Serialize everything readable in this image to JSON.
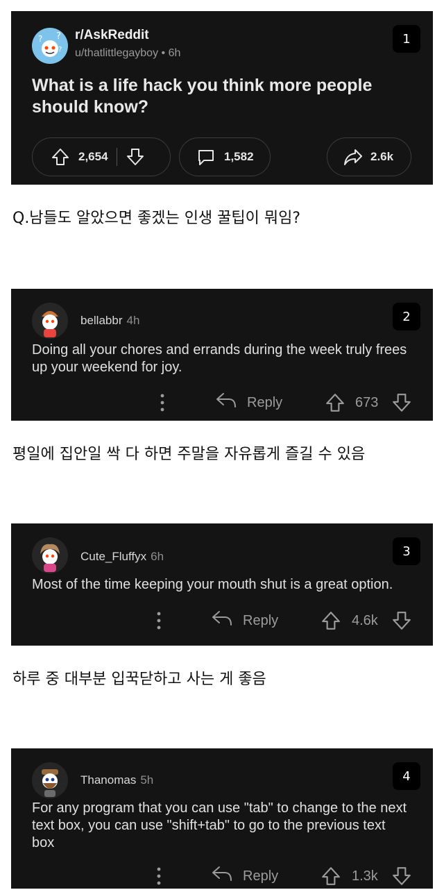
{
  "post": {
    "subreddit": "r/AskReddit",
    "author": "u/thatlittlegayboy",
    "age": "6h",
    "title": "What is a life hack you think more people should know?",
    "upvotes": "2,654",
    "comments": "1,582",
    "shares": "2.6k",
    "number": "1"
  },
  "captions": [
    "Q.남들도 알았으면 좋겠는 인생 꿀팁이 뭐임?",
    "평일에 집안일 싹 다 하면 주말을 자유롭게 즐길 수 있음",
    "하루 중 대부분 입꾹닫하고 사는 게 좋음"
  ],
  "reply_label": "Reply",
  "comments": [
    {
      "number": "2",
      "user": "bellabbr",
      "age": "4h",
      "text": "Doing all your chores and errands during the week truly frees up your weekend for joy.",
      "score": "673"
    },
    {
      "number": "3",
      "user": "Cute_Fluffyx",
      "age": "6h",
      "text": "Most of the time keeping your mouth shut is a great option.",
      "score": "4.6k"
    },
    {
      "number": "4",
      "user": "Thanomas",
      "age": "5h",
      "text": "For any program that you can use \"tab\" to change to the next text box, you can use \"shift+tab\" to go to the previous text box",
      "score": "1.3k"
    }
  ],
  "colors": {
    "card_bg": "#141414",
    "page_bg": "#ffffff",
    "muted": "#9c9c9c",
    "avatar_blue": "#7dc3ec"
  }
}
